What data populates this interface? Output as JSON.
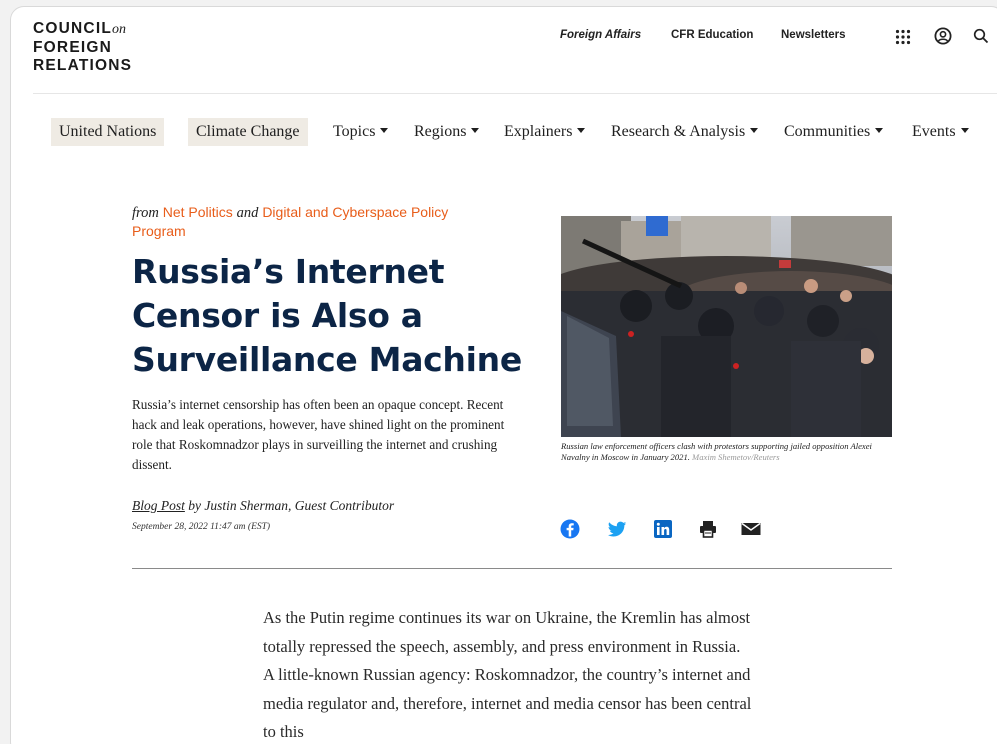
{
  "header": {
    "logo": {
      "line1": "COUNCIL",
      "on": "on",
      "line2": "FOREIGN",
      "line3": "RELATIONS"
    },
    "links": [
      "Foreign Affairs",
      "CFR Education",
      "Newsletters"
    ],
    "icons": [
      "grid-icon",
      "user-icon",
      "search-icon"
    ]
  },
  "nav": {
    "items": [
      {
        "label": "United Nations"
      },
      {
        "label": "Climate Change"
      },
      {
        "label": "Topics"
      },
      {
        "label": "Regions"
      },
      {
        "label": "Explainers"
      },
      {
        "label": "Research & Analysis"
      },
      {
        "label": "Communities"
      },
      {
        "label": "Events"
      }
    ]
  },
  "article": {
    "from_prefix": "from",
    "from_link1": "Net Politics",
    "from_and": "and",
    "from_link2": "Digital and Cyberspace Policy Program",
    "headline": "Russia’s Internet Censor is Also a Surveillance Machine",
    "dek": "Russia’s internet censorship has often been an opaque concept. Recent hack and leak operations, however, have shined light on the prominent role that Roskomnadzor plays in surveilling the internet and crushing dissent.",
    "type": "Blog Post",
    "byline": "by Justin Sherman, Guest Contributor",
    "date": "September 28, 2022 11:47 am (EST)",
    "caption": "Russian law enforcement officers clash with protestors supporting jailed opposition Alexei Navalny in Moscow in January 2021.",
    "credit": "Maxim Shemetov/Reuters",
    "share_icons": [
      "facebook-icon",
      "twitter-icon",
      "linkedin-icon",
      "print-icon",
      "email-icon"
    ],
    "body": "As the Putin regime continues its war on Ukraine, the Kremlin has almost totally repressed the speech, assembly, and press environment in Russia. A little-known Russian agency: Roskomnadzor, the country’s internet and media regulator and, therefore, internet and media censor has been central to this"
  },
  "colors": {
    "accent": "#e85d1a",
    "headline": "#0c2546",
    "nav_highlight": "#efebe4",
    "facebook": "#1877f2",
    "twitter": "#1da1f2",
    "linkedin": "#0a66c2"
  }
}
